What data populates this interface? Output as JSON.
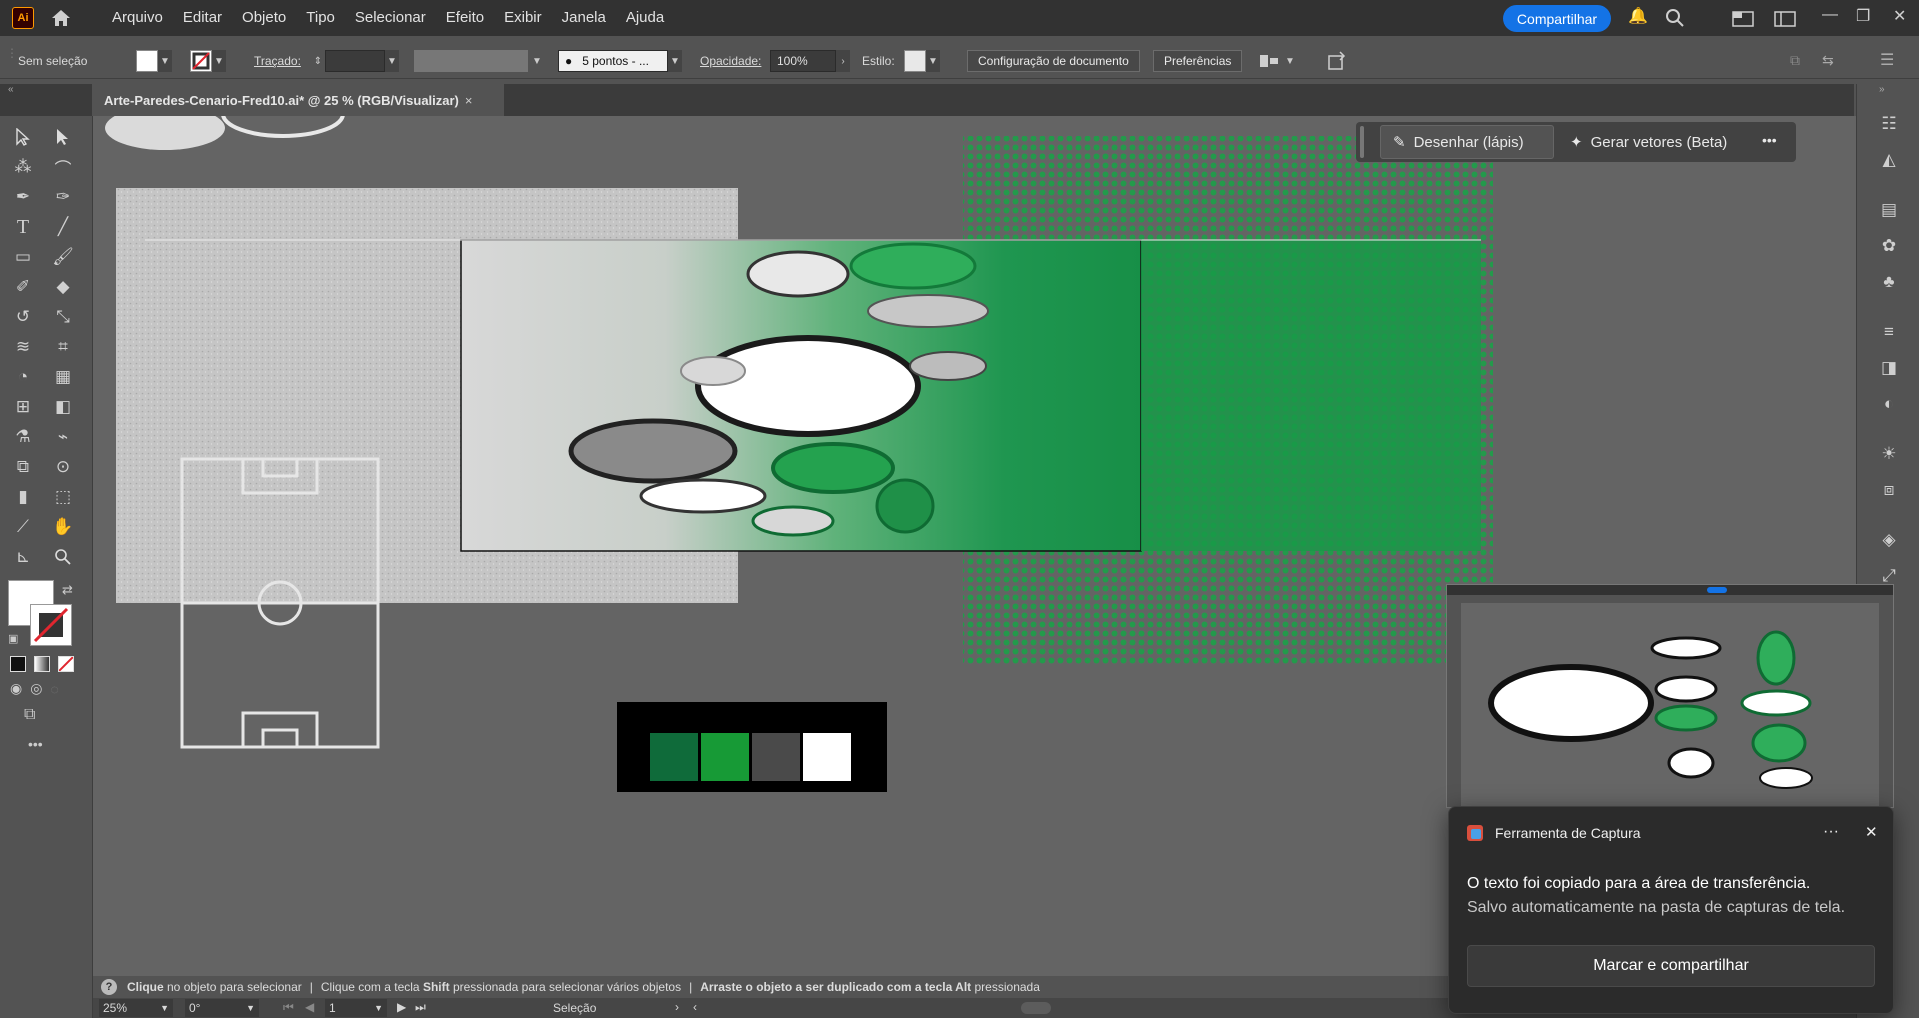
{
  "app": {
    "logo": "Ai",
    "menus": [
      "Arquivo",
      "Editar",
      "Objeto",
      "Tipo",
      "Selecionar",
      "Efeito",
      "Exibir",
      "Janela",
      "Ajuda"
    ],
    "share_label": "Compartilhar"
  },
  "control_bar": {
    "selection": "Sem seleção",
    "stroke_label": "Traçado:",
    "brush": "5 pontos - ...",
    "opacity_label": "Opacidade:",
    "opacity_value": "100%",
    "style_label": "Estilo:",
    "doc_setup": "Configuração de documento",
    "prefs": "Preferências"
  },
  "document": {
    "tab_title": "Arte-Paredes-Cenario-Fred10.ai* @ 25 % (RGB/Visualizar)",
    "close": "×"
  },
  "context_bar": {
    "draw": "Desenhar (lápis)",
    "vectors": "Gerar vetores (Beta)",
    "more": "•••"
  },
  "palette": {
    "colors": [
      "#0f6b3a",
      "#179a36",
      "#4a4a4a",
      "#ffffff"
    ]
  },
  "status": {
    "parts": [
      {
        "bold": "Clique",
        "text": " no objeto para selecionar"
      },
      {
        "bold": "",
        "text": "Clique com a tecla "
      },
      {
        "bold": "Shift",
        "text": " pressionada para selecionar vários objetos"
      },
      {
        "bold": "Arraste o objeto a ser duplicado com a tecla Alt",
        "text": " pressionada"
      }
    ],
    "sep": "|"
  },
  "bottom_bar": {
    "zoom": "25%",
    "rotation": "0°",
    "artboard": "1",
    "mode": "Seleção"
  },
  "toast": {
    "app": "Ferramenta de Captura",
    "more": "···",
    "close": "✕",
    "msg1": "O texto foi copiado para a área de transferência.",
    "msg2": "Salvo automaticamente na pasta de capturas de tela.",
    "button": "Marcar e compartilhar"
  },
  "colors": {
    "ui_dark": "#323232",
    "ui_mid": "#535353",
    "canvas": "#646464",
    "accent": "#1473e6",
    "green": "#179a48"
  }
}
